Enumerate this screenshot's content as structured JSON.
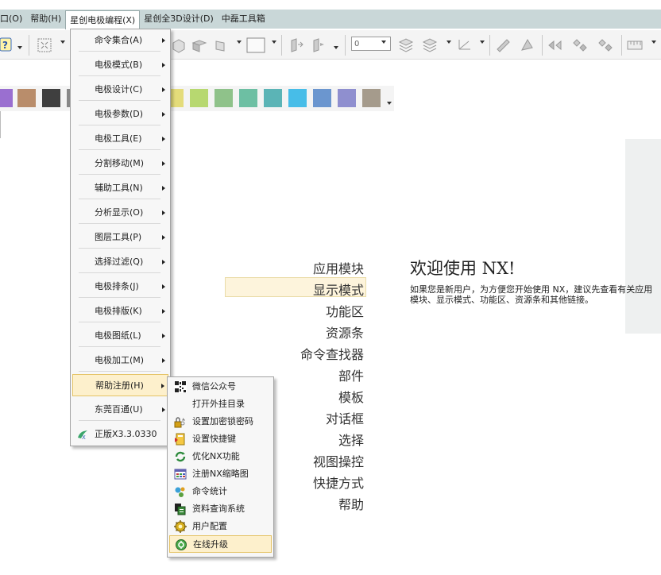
{
  "menubar": {
    "items": [
      {
        "label": "口(O)"
      },
      {
        "label": "帮助(H)"
      },
      {
        "label": "星创电极编程(X)"
      },
      {
        "label": "星创全3D设计(D)"
      },
      {
        "label": "中磊工具箱"
      }
    ]
  },
  "toolbar": {
    "layer_combo_value": "0"
  },
  "palette": {
    "colors": [
      "#9a6fd0",
      "#b98d6b",
      "#3f3f3f",
      "#888888",
      "#e4dc7a",
      "#b7d870",
      "#8fc28a",
      "#6dbfa3",
      "#5bb4b6",
      "#47bde8",
      "#6b96cf",
      "#8f8fcf",
      "#a59b8c"
    ]
  },
  "main_menu": {
    "items": [
      {
        "label": "命令集合(A)",
        "name": "command-collection",
        "submenu": true
      },
      {
        "label": "电极模式(B)",
        "name": "electrode-mode",
        "submenu": true
      },
      {
        "label": "电极设计(C)",
        "name": "electrode-design",
        "submenu": true
      },
      {
        "label": "电极参数(D)",
        "name": "electrode-params",
        "submenu": true
      },
      {
        "label": "电极工具(E)",
        "name": "electrode-tools",
        "submenu": true
      },
      {
        "label": "分割移动(M)",
        "name": "split-move",
        "submenu": true
      },
      {
        "label": "辅助工具(N)",
        "name": "aux-tools",
        "submenu": true
      },
      {
        "label": "分析显示(O)",
        "name": "analysis-display",
        "submenu": true
      },
      {
        "label": "图层工具(P)",
        "name": "layer-tools",
        "submenu": true
      },
      {
        "label": "选择过滤(Q)",
        "name": "selection-filter",
        "submenu": true
      },
      {
        "label": "电极排条(J)",
        "name": "electrode-strip",
        "submenu": true
      },
      {
        "label": "电极排版(K)",
        "name": "electrode-layout",
        "submenu": true
      },
      {
        "label": "电极图纸(L)",
        "name": "electrode-drawing",
        "submenu": true
      },
      {
        "label": "电极加工(M)",
        "name": "electrode-machining",
        "submenu": true
      },
      {
        "label": "帮助注册(H)",
        "name": "help-register",
        "submenu": true
      },
      {
        "label": "东莞百通(U)",
        "name": "dongguan-baitong",
        "submenu": true
      },
      {
        "label": "正版X3.3.0330",
        "name": "version",
        "submenu": false
      }
    ]
  },
  "help_submenu": {
    "items": [
      {
        "label": "微信公众号",
        "icon": "qr-code-icon"
      },
      {
        "label": "打开外挂目录",
        "icon": ""
      },
      {
        "label": "设置加密锁密码",
        "icon": "lock-key-icon"
      },
      {
        "label": "设置快捷键",
        "icon": "shortcut-icon"
      },
      {
        "label": "优化NX功能",
        "icon": "optimize-icon"
      },
      {
        "label": "注册NX缩略图",
        "icon": "thumbnail-icon"
      },
      {
        "label": "命令统计",
        "icon": "statistics-icon"
      },
      {
        "label": "资料查询系统",
        "icon": "database-icon"
      },
      {
        "label": "用户配置",
        "icon": "user-config-icon"
      },
      {
        "label": "在线升级",
        "icon": "online-upgrade-icon"
      }
    ]
  },
  "nav": {
    "items": [
      "应用模块",
      "显示模式",
      "功能区",
      "资源条",
      "命令查找器",
      "部件",
      "模板",
      "对话框",
      "选择",
      "视图操控",
      "快捷方式",
      "帮助"
    ]
  },
  "welcome": {
    "title": "欢迎使用 NX!",
    "description": "如果您是新用户，为方便您开始使用 NX，建议先查看有关应用模块、显示模式、功能区、资源条和其他链接。"
  }
}
